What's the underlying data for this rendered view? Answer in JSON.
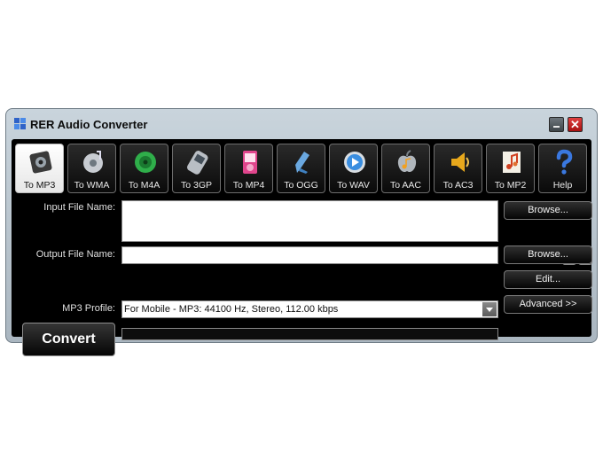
{
  "window": {
    "title": "RER Audio Converter",
    "close_glyph": "✕"
  },
  "toolbar": {
    "items": [
      {
        "label": "To MP3",
        "icon": "speaker-icon"
      },
      {
        "label": "To WMA",
        "icon": "disc-icon"
      },
      {
        "label": "To M4A",
        "icon": "green-disc-icon"
      },
      {
        "label": "To 3GP",
        "icon": "phone-icon"
      },
      {
        "label": "To MP4",
        "icon": "media-player-icon"
      },
      {
        "label": "To OGG",
        "icon": "pen-icon"
      },
      {
        "label": "To WAV",
        "icon": "play-icon"
      },
      {
        "label": "To AAC",
        "icon": "apple-music-icon"
      },
      {
        "label": "To AC3",
        "icon": "speaker-cone-icon"
      },
      {
        "label": "To MP2",
        "icon": "music-notes-icon"
      },
      {
        "label": "Help",
        "icon": "help-icon"
      }
    ]
  },
  "form": {
    "input_label": "Input File Name:",
    "input_value": "",
    "output_label": "Output File Name:",
    "output_value": "",
    "profile_label": "MP3 Profile:",
    "profile_value": "For Mobile - MP3: 44100 Hz, Stereo, 112.00 kbps",
    "browse_input": "Browse...",
    "browse_output": "Browse...",
    "edit": "Edit...",
    "advanced": "Advanced >>",
    "add": "+",
    "remove": "−",
    "convert": "Convert",
    "progress": 0
  }
}
